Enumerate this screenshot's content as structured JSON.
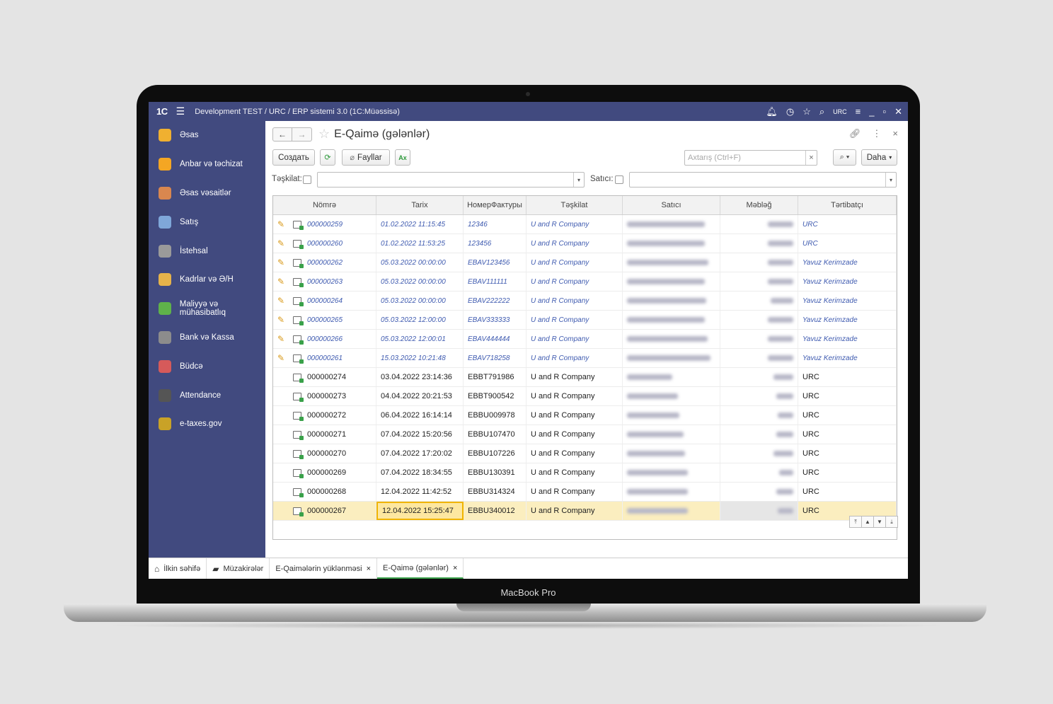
{
  "window": {
    "app_title": "Development TEST / URC / ERP sistemi 3.0  (1C:Müəssisə)",
    "logo": "1C",
    "user_short": "URC"
  },
  "laptop": {
    "brand": "MacBook Pro"
  },
  "sidebar": {
    "items": [
      {
        "label": "Əsas",
        "icon": "home-desk-icon",
        "color": "#f0b030"
      },
      {
        "label": "Anbar və təchizat",
        "icon": "warehouse-box-icon",
        "color": "#f4a623"
      },
      {
        "label": "Əsas vəsaitlər",
        "icon": "fixed-assets-icon",
        "color": "#d9874f"
      },
      {
        "label": "Satış",
        "icon": "sales-register-icon",
        "color": "#7fa7d9"
      },
      {
        "label": "İstehsal",
        "icon": "production-gear-icon",
        "color": "#9a9a9a"
      },
      {
        "label": "Kadrlar və Ə/H",
        "icon": "people-icon",
        "color": "#e6b34a"
      },
      {
        "label": "Maliyyə və mühasibatlıq",
        "icon": "finance-pie-icon",
        "color": "#5fb24a"
      },
      {
        "label": "Bank və Kassa",
        "icon": "bank-cash-icon",
        "color": "#8c8c8c"
      },
      {
        "label": "Büdcə",
        "icon": "budget-icon",
        "color": "#d65a5a"
      },
      {
        "label": "Attendance",
        "icon": "attendance-icon",
        "color": "#555555"
      },
      {
        "label": "e-taxes.gov",
        "icon": "etaxes-emblem-icon",
        "color": "#c9a227"
      }
    ]
  },
  "form": {
    "title": "E-Qaimə (gələnlər)",
    "create_label": "Создать",
    "files_label": "Fayllar",
    "search_placeholder": "Axtarış (Ctrl+F)",
    "more_label": "Daha",
    "filter_org_label": "Təşkilat:",
    "filter_seller_label": "Satıcı:"
  },
  "table": {
    "columns": [
      "Nömrə",
      "Tarix",
      "НомерФактуры",
      "Təşkilat",
      "Satıcı",
      "Məbləğ",
      "Tərtibatçı"
    ],
    "rows": [
      {
        "number": "000000259",
        "date": "01.02.2022 11:15:45",
        "invoice": "12346",
        "org": "U and R Company",
        "author": "URC",
        "draft": true
      },
      {
        "number": "000000260",
        "date": "01.02.2022 11:53:25",
        "invoice": "123456",
        "org": "U and R Company",
        "author": "URC",
        "draft": true
      },
      {
        "number": "000000262",
        "date": "05.03.2022 00:00:00",
        "invoice": "EBAV123456",
        "org": "U and R Company",
        "author": "Yavuz Kerimzade",
        "draft": true
      },
      {
        "number": "000000263",
        "date": "05.03.2022 00:00:00",
        "invoice": "EBAV111111",
        "org": "U and R Company",
        "author": "Yavuz Kerimzade",
        "draft": true
      },
      {
        "number": "000000264",
        "date": "05.03.2022 00:00:00",
        "invoice": "EBAV222222",
        "org": "U and R Company",
        "author": "Yavuz Kerimzade",
        "draft": true
      },
      {
        "number": "000000265",
        "date": "05.03.2022 12:00:00",
        "invoice": "EBAV333333",
        "org": "U and R Company",
        "author": "Yavuz Kerimzade",
        "draft": true
      },
      {
        "number": "000000266",
        "date": "05.03.2022 12:00:01",
        "invoice": "EBAV444444",
        "org": "U and R Company",
        "author": "Yavuz Kerimzade",
        "draft": true
      },
      {
        "number": "000000261",
        "date": "15.03.2022 10:21:48",
        "invoice": "EBAV718258",
        "org": "U and R Company",
        "author": "Yavuz Kerimzade",
        "draft": true
      },
      {
        "number": "000000274",
        "date": "03.04.2022 23:14:36",
        "invoice": "EBBT791986",
        "org": "U and R Company",
        "author": "URC",
        "draft": false
      },
      {
        "number": "000000273",
        "date": "04.04.2022 20:21:53",
        "invoice": "EBBT900542",
        "org": "U and R Company",
        "author": "URC",
        "draft": false
      },
      {
        "number": "000000272",
        "date": "06.04.2022 16:14:14",
        "invoice": "EBBU009978",
        "org": "U and R Company",
        "author": "URC",
        "draft": false
      },
      {
        "number": "000000271",
        "date": "07.04.2022 15:20:56",
        "invoice": "EBBU107470",
        "org": "U and R Company",
        "author": "URC",
        "draft": false
      },
      {
        "number": "000000270",
        "date": "07.04.2022 17:20:02",
        "invoice": "EBBU107226",
        "org": "U and R Company",
        "author": "URC",
        "draft": false
      },
      {
        "number": "000000269",
        "date": "07.04.2022 18:34:55",
        "invoice": "EBBU130391",
        "org": "U and R Company",
        "author": "URC",
        "draft": false
      },
      {
        "number": "000000268",
        "date": "12.04.2022 11:42:52",
        "invoice": "EBBU314324",
        "org": "U and R Company",
        "author": "URC",
        "draft": false
      },
      {
        "number": "000000267",
        "date": "12.04.2022 15:25:47",
        "invoice": "EBBU340012",
        "org": "U and R Company",
        "author": "URC",
        "draft": false,
        "selected": true
      }
    ]
  },
  "tabs": [
    {
      "label": "İlkin səhifə",
      "icon": "home-icon"
    },
    {
      "label": "Müzakirələr",
      "icon": "chat-icon"
    },
    {
      "label": "E-Qaimələrin yüklənməsi",
      "closable": true
    },
    {
      "label": "E-Qaimə (gələnlər)",
      "closable": true,
      "active": true
    }
  ]
}
